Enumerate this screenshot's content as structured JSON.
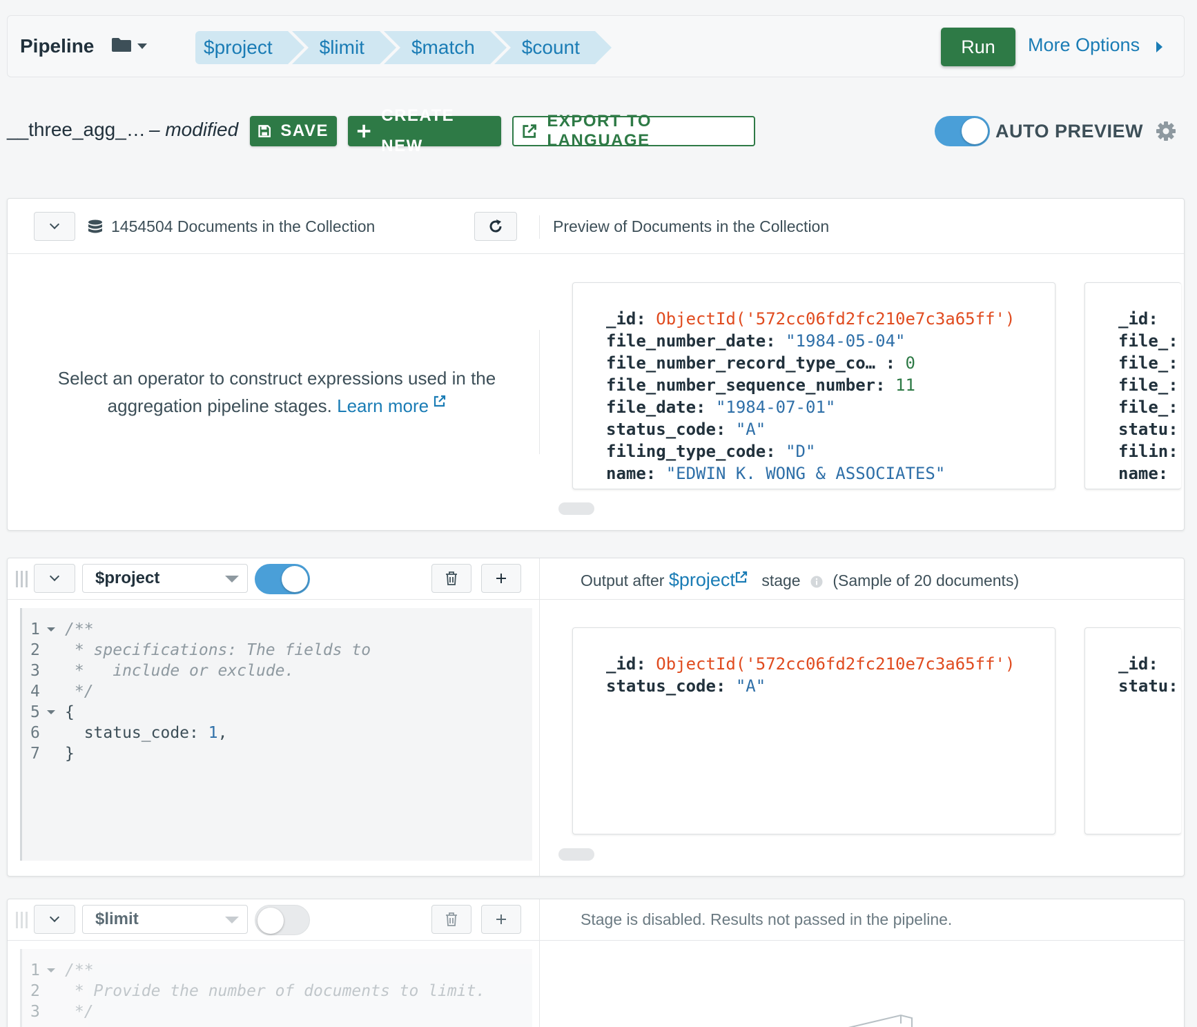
{
  "header": {
    "title": "Pipeline",
    "stages": [
      "$project",
      "$limit",
      "$match",
      "$count"
    ],
    "run_label": "Run",
    "more_options_label": "More Options"
  },
  "toolbar": {
    "pipeline_name": "__three_agg_…",
    "modified_label": "– modified",
    "save_label": "SAVE",
    "create_new_label": "CREATE NEW",
    "export_label": "EXPORT TO LANGUAGE",
    "auto_preview_label": "AUTO PREVIEW",
    "auto_preview_on": true
  },
  "collection_panel": {
    "doc_count_label": "1454504 Documents in the Collection",
    "preview_label": "Preview of Documents in the Collection",
    "help_text": "Select an operator to construct expressions used in the aggregation pipeline stages.",
    "learn_more_label": "Learn more",
    "documents": [
      {
        "fields": [
          {
            "key": "_id",
            "value": "ObjectId('572cc06fd2fc210e7c3a65ff')",
            "type": "oid"
          },
          {
            "key": "file_number_date",
            "value": "\"1984-05-04\"",
            "type": "str"
          },
          {
            "key": "file_number_record_type_co… ",
            "value": "0",
            "type": "num"
          },
          {
            "key": "file_number_sequence_number",
            "value": "11",
            "type": "num"
          },
          {
            "key": "file_date",
            "value": "\"1984-07-01\"",
            "type": "str"
          },
          {
            "key": "status_code",
            "value": "\"A\"",
            "type": "str"
          },
          {
            "key": "filing_type_code",
            "value": "\"D\"",
            "type": "str"
          },
          {
            "key": "name",
            "value": "\"EDWIN K. WONG & ASSOCIATES\"",
            "type": "str"
          }
        ]
      },
      {
        "fields": [
          {
            "key": "_id:",
            "value": "",
            "type": "oid"
          },
          {
            "key": "file_",
            "value": "",
            "type": "str"
          },
          {
            "key": "file_",
            "value": "",
            "type": "str"
          },
          {
            "key": "file_",
            "value": "",
            "type": "str"
          },
          {
            "key": "file_",
            "value": "",
            "type": "str"
          },
          {
            "key": "statu",
            "value": "",
            "type": "str"
          },
          {
            "key": "filin",
            "value": "",
            "type": "str"
          },
          {
            "key": "name:",
            "value": "",
            "type": "str"
          }
        ]
      }
    ]
  },
  "stage1": {
    "operator": "$project",
    "enabled": true,
    "output_prefix": "Output after",
    "output_stage": "$project",
    "output_suffix": "stage",
    "sample_label": "(Sample of 20 documents)",
    "code": [
      {
        "n": "1",
        "fold": true,
        "text": "/**",
        "cls": "cmt"
      },
      {
        "n": "2",
        "fold": false,
        "text": " * specifications: The fields to",
        "cls": "cmt"
      },
      {
        "n": "3",
        "fold": false,
        "text": " *   include or exclude.",
        "cls": "cmt"
      },
      {
        "n": "4",
        "fold": false,
        "text": " */",
        "cls": "cmt"
      },
      {
        "n": "5",
        "fold": true,
        "text": "{",
        "cls": ""
      },
      {
        "n": "6",
        "fold": false,
        "text": "  status_code: ",
        "cls": "",
        "num": "1",
        "tail": ","
      },
      {
        "n": "7",
        "fold": false,
        "text": "}",
        "cls": ""
      }
    ],
    "documents": [
      {
        "fields": [
          {
            "key": "_id",
            "value": "ObjectId('572cc06fd2fc210e7c3a65ff')",
            "type": "oid"
          },
          {
            "key": "status_code",
            "value": "\"A\"",
            "type": "str"
          }
        ]
      },
      {
        "fields": [
          {
            "key": "_id:",
            "value": "",
            "type": "oid"
          },
          {
            "key": "statu",
            "value": "",
            "type": "str"
          }
        ]
      }
    ]
  },
  "stage2": {
    "operator": "$limit",
    "enabled": false,
    "disabled_message": "Stage is disabled. Results not passed in the pipeline.",
    "code": [
      {
        "n": "1",
        "fold": true,
        "text": "/**",
        "cls": "cmt"
      },
      {
        "n": "2",
        "fold": false,
        "text": " * Provide the number of documents to limit.",
        "cls": "cmt"
      },
      {
        "n": "3",
        "fold": false,
        "text": " */",
        "cls": "cmt"
      }
    ]
  },
  "colors": {
    "green": "#2e7a46",
    "blue_link": "#1a7cb5",
    "toggle_on": "#4a9fd8",
    "objectid": "#e04b1f"
  }
}
